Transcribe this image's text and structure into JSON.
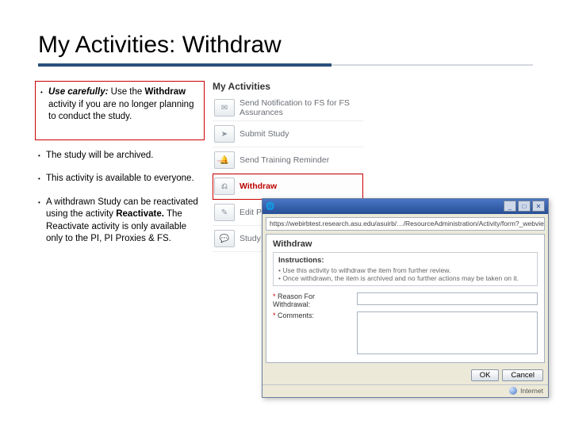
{
  "title": "My Activities: Withdraw",
  "bullets": {
    "b1_strong1": "Use carefully:",
    "b1_rest1": " Use the ",
    "b1_strong2": "Withdraw",
    "b1_rest2": " activity if you are no longer planning to conduct the study.",
    "b2": "The study will be archived.",
    "b3": "This activity is available to everyone.",
    "b4_pre": "A withdrawn Study can be reactivated using the activity ",
    "b4_strong": "Reactivate.",
    "b4_post": " The Reactivate activity is only available only to the PI, PI Proxies & FS."
  },
  "activities": {
    "header": "My Activities",
    "items": [
      "Send Notification to FS for FS Assurances",
      "Submit Study",
      "Send Training Reminder",
      "Withdraw",
      "Edit PI Proxy",
      "Study Team Comment"
    ]
  },
  "dialog": {
    "url": "https://webirbtest.research.asu.edu/asuirb/…/ResourceAdministration/Activity/form?_webview&ActivityType=com…",
    "heading": "Withdraw",
    "instructions_label": "Instructions:",
    "instructions_1": "Use this activity to withdraw the item from further review.",
    "instructions_2": "Once withdrawn, the item is archived and no further actions may be taken on it.",
    "reason_label": "Reason For Withdrawal:",
    "comments_label": "Comments:",
    "ok": "OK",
    "cancel": "Cancel",
    "internet": "Internet"
  }
}
